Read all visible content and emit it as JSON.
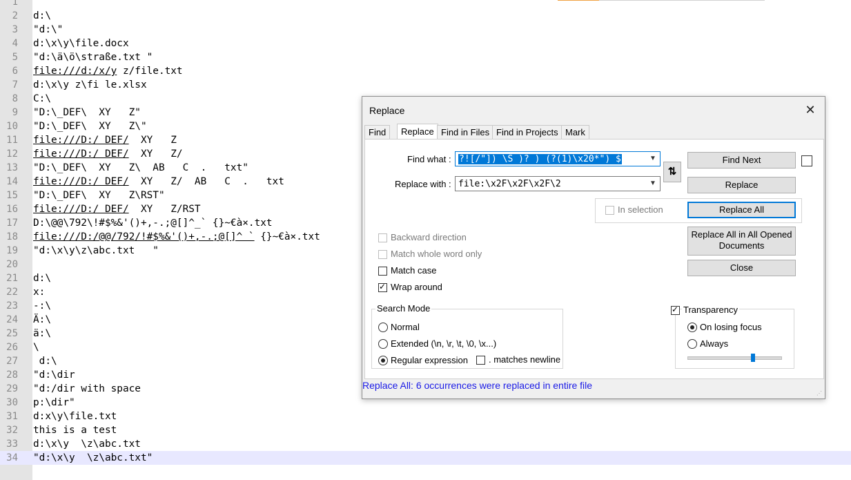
{
  "editor": {
    "lines": [
      {
        "n": "1",
        "t": "",
        "link": ""
      },
      {
        "n": "2",
        "t": "d:\\",
        "link": ""
      },
      {
        "n": "3",
        "t": "\"d:\\\"",
        "link": ""
      },
      {
        "n": "4",
        "t": "d:\\x\\y\\file.docx",
        "link": ""
      },
      {
        "n": "5",
        "t": "\"d:\\ä\\ö\\straße.txt \"",
        "link": ""
      },
      {
        "n": "6",
        "t": " z/file.txt",
        "link": "file:///d:/x/y"
      },
      {
        "n": "7",
        "t": "d:\\x\\y z\\fi le.xlsx",
        "link": ""
      },
      {
        "n": "8",
        "t": "C:\\",
        "link": ""
      },
      {
        "n": "9",
        "t": "\"D:\\_DEF\\  XY   Z\"",
        "link": ""
      },
      {
        "n": "10",
        "t": "\"D:\\_DEF\\  XY   Z\\\"",
        "link": ""
      },
      {
        "n": "11",
        "t": "  XY   Z",
        "link": "file:///D:/ DEF/"
      },
      {
        "n": "12",
        "t": "  XY   Z/",
        "link": "file:///D:/ DEF/"
      },
      {
        "n": "13",
        "t": "\"D:\\_DEF\\  XY   Z\\  AB   C  .   txt\"",
        "link": ""
      },
      {
        "n": "14",
        "t": "  XY   Z/  AB   C  .   txt",
        "link": "file:///D:/ DEF/"
      },
      {
        "n": "15",
        "t": "\"D:\\_DEF\\  XY   Z\\RST\"",
        "link": ""
      },
      {
        "n": "16",
        "t": "  XY   Z/RST",
        "link": "file:///D:/ DEF/"
      },
      {
        "n": "17",
        "t": "D:\\@@\\792\\!#$%&'()+,-.;@[]^_` {}~€à×.txt",
        "link": ""
      },
      {
        "n": "18",
        "t": " {}~€à×.txt",
        "link": "file:///D:/@@/792/!#$%&'()+,-.;@[]^ `"
      },
      {
        "n": "19",
        "t": "\"d:\\x\\y\\z\\abc.txt   \"",
        "link": ""
      },
      {
        "n": "20",
        "t": "",
        "link": ""
      },
      {
        "n": "21",
        "t": "d:\\",
        "link": ""
      },
      {
        "n": "22",
        "t": "x:",
        "link": ""
      },
      {
        "n": "23",
        "t": "-:\\",
        "link": ""
      },
      {
        "n": "24",
        "t": "Ä:\\",
        "link": ""
      },
      {
        "n": "25",
        "t": "ä:\\",
        "link": ""
      },
      {
        "n": "26",
        "t": "\\",
        "link": ""
      },
      {
        "n": "27",
        "t": " d:\\",
        "link": ""
      },
      {
        "n": "28",
        "t": "\"d:\\dir",
        "link": ""
      },
      {
        "n": "29",
        "t": "\"d:/dir with space",
        "link": ""
      },
      {
        "n": "30",
        "t": "p:\\dir\"",
        "link": ""
      },
      {
        "n": "31",
        "t": "d:x\\y\\file.txt",
        "link": ""
      },
      {
        "n": "32",
        "t": "this is a test",
        "link": ""
      },
      {
        "n": "33",
        "t": "d:\\x\\y  \\z\\abc.txt",
        "link": ""
      },
      {
        "n": "34",
        "t": "\"d:\\x\\y  \\z\\abc.txt\"",
        "link": ""
      }
    ]
  },
  "dialog": {
    "title": "Replace",
    "close_glyph": "✕",
    "tabs": [
      "Find",
      "Replace",
      "Find in Files",
      "Find in Projects",
      "Mark"
    ],
    "find_label": "Find what :",
    "find_value": "?![/\"]) \\S )? ) (?(1)\\x20*\") $",
    "replace_label": "Replace with :",
    "replace_value": "file:\\x2F\\x2F\\x2F\\2",
    "swap_glyph": "⇅",
    "buttons": {
      "find_next": "Find Next",
      "replace": "Replace",
      "replace_all": "Replace All",
      "replace_all_opened_1": "Replace All in All Opened",
      "replace_all_opened_2": "Documents",
      "close": "Close"
    },
    "in_selection": "In selection",
    "options": {
      "backward": "Backward direction",
      "whole_word": "Match whole word only",
      "match_case": "Match case",
      "wrap_around": "Wrap around"
    },
    "search_mode": {
      "title": "Search Mode",
      "normal": "Normal",
      "extended": "Extended (\\n, \\r, \\t, \\0, \\x...)",
      "regex": "Regular expression",
      "dot_newline": ". matches newline"
    },
    "transparency": {
      "title": "Transparency",
      "on_losing_focus": "On losing focus",
      "always": "Always",
      "level": 0.7
    },
    "status": "Replace All: 6 occurrences were replaced in entire file"
  }
}
